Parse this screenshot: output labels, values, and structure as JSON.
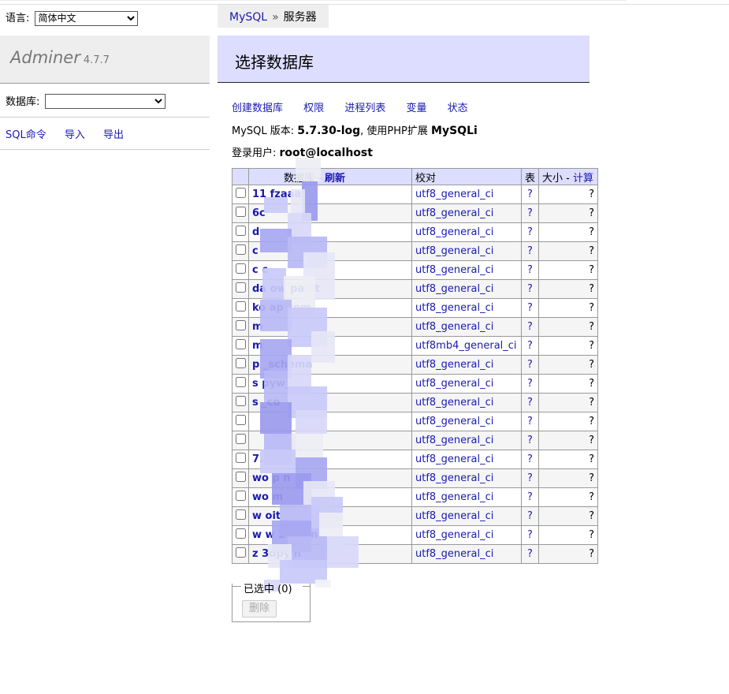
{
  "language": {
    "label": "语言:",
    "selected": "简体中文"
  },
  "brand": {
    "name": "Adminer",
    "version": "4.7.7"
  },
  "db_select": {
    "label": "数据库:",
    "selected": ""
  },
  "menu_links": [
    "SQL命令",
    "导入",
    "导出"
  ],
  "breadcrumb": {
    "root": "MySQL",
    "separator": "»",
    "current": "服务器"
  },
  "heading": "选择数据库",
  "actions": [
    "创建数据库",
    "权限",
    "进程列表",
    "变量",
    "状态"
  ],
  "server_info": {
    "version_label": "MySQL 版本:",
    "version": "5.7.30-log",
    "ext_text": ", 使用PHP扩展",
    "ext": "MySQLi",
    "user_label": "登录用户:",
    "user": "root@localhost"
  },
  "table": {
    "headers": {
      "database": "数据库",
      "refresh": "刷新",
      "collation": "校对",
      "tables": "表",
      "size": "大小",
      "compute": "计算"
    },
    "rows": [
      {
        "name": "11          fzaaa",
        "collation": "utf8_general_ci",
        "tables": "?",
        "size": "?"
      },
      {
        "name": "6c",
        "collation": "utf8_general_ci",
        "tables": "?",
        "size": "?"
      },
      {
        "name": "d",
        "collation": "utf8_general_ci",
        "tables": "?",
        "size": "?"
      },
      {
        "name": "c",
        "collation": "utf8_general_ci",
        "tables": "?",
        "size": "?"
      },
      {
        "name": "c       c",
        "collation": "utf8_general_ci",
        "tables": "?",
        "size": "?"
      },
      {
        "name": "da     ow      paoit",
        "collation": "utf8_general_ci",
        "tables": "?",
        "size": "?"
      },
      {
        "name": "ko      ap       com",
        "collation": "utf8_general_ci",
        "tables": "?",
        "size": "?"
      },
      {
        "name": "m",
        "collation": "utf8_general_ci",
        "tables": "?",
        "size": "?"
      },
      {
        "name": "m",
        "collation": "utf8mb4_general_ci",
        "tables": "?",
        "size": "?"
      },
      {
        "name": "p              _schema",
        "collation": "utf8_general_ci",
        "tables": "?",
        "size": "?"
      },
      {
        "name": "s              pyw_",
        "collation": "utf8_general_ci",
        "tables": "?",
        "size": "?"
      },
      {
        "name": "s              _co",
        "collation": "utf8_general_ci",
        "tables": "?",
        "size": "?"
      },
      {
        "name": "",
        "collation": "utf8_general_ci",
        "tables": "?",
        "size": "?"
      },
      {
        "name": "",
        "collation": "utf8_general_ci",
        "tables": "?",
        "size": "?"
      },
      {
        "name": "           7.     w",
        "collation": "utf8_general_ci",
        "tables": "?",
        "size": "?"
      },
      {
        "name": "wo          p       n",
        "collation": "utf8_general_ci",
        "tables": "?",
        "size": "?"
      },
      {
        "name": "wo                m",
        "collation": "utf8_general_ci",
        "tables": "?",
        "size": "?"
      },
      {
        "name": "w           oit_",
        "collation": "utf8_general_ci",
        "tables": "?",
        "size": "?"
      },
      {
        "name": "w     w    24dp       n",
        "collation": "utf8_general_ci",
        "tables": "?",
        "size": "?"
      },
      {
        "name": "z          3dpy      n",
        "collation": "utf8_general_ci",
        "tables": "?",
        "size": "?"
      }
    ]
  },
  "selection": {
    "legend": "已选中 (0)",
    "delete_label": "删除"
  },
  "colors": {
    "header_bg": "#ddf",
    "link": "#1a1ab0",
    "pixelation": "#9f9ff2"
  }
}
